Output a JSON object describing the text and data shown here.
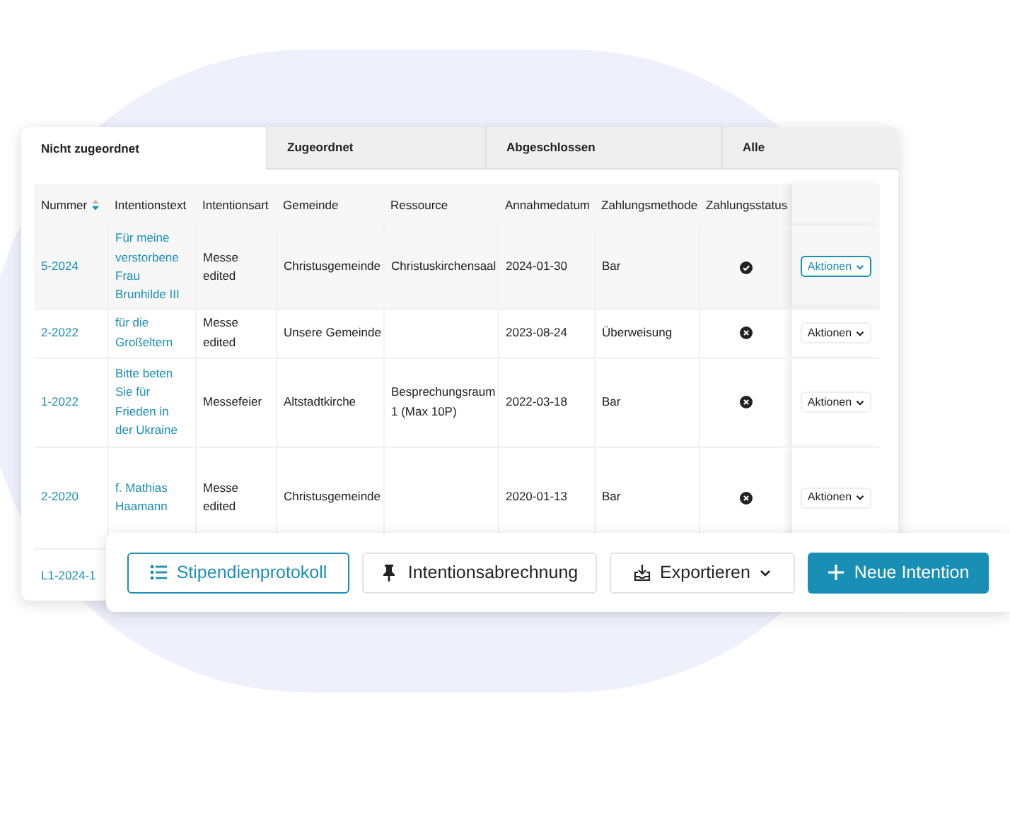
{
  "tabs": [
    {
      "label": "Nicht zugeordnet",
      "selected": true
    },
    {
      "label": "Zugeordnet",
      "selected": false
    },
    {
      "label": "Abgeschlossen",
      "selected": false
    },
    {
      "label": "Alle",
      "selected": false
    }
  ],
  "table": {
    "columns": [
      "Nummer",
      "Intentionstext",
      "Intentionsart",
      "Gemeinde",
      "Ressource",
      "Annahmedatum",
      "Zahlungsmethode",
      "Zahlungsstatus"
    ],
    "rows": [
      {
        "number": "5-2024",
        "text": "Für meine verstorbene Frau Brunhilde III",
        "type": "Messe edited",
        "parish": "Christusgemeinde",
        "resource": "Christuskirchensaal",
        "date": "2024-01-30",
        "payment": "Bar",
        "paid": true,
        "action": "Aktionen",
        "selected": true
      },
      {
        "number": "2-2022",
        "text": "für die Großeltern",
        "type": "Messe edited",
        "parish": "Unsere Gemeinde",
        "date": "2023-08-24",
        "payment": "Überweisung",
        "paid": false,
        "action": "Aktionen",
        "selected": false
      },
      {
        "number": "1-2022",
        "text": "Bitte beten Sie für Frieden in der Ukraine",
        "type": "Messefeier",
        "parish": "Altstadtkirche",
        "resource": "Besprechungsraum 1 (Max 10P)",
        "date": "2022-03-18",
        "payment": "Bar",
        "paid": false,
        "action": "Aktionen",
        "selected": false
      },
      {
        "number": "2-2020",
        "text": "f. Mathias Haamann",
        "type": "Messe edited",
        "parish": "Christusgemeinde",
        "date": "2020-01-13",
        "payment": "Bar",
        "paid": false,
        "action": "Aktionen",
        "selected": false
      },
      {
        "number": "L1-2024-1"
      }
    ]
  },
  "toolbar": [
    {
      "kind": "outline",
      "label": "Stipendienprotokoll"
    },
    {
      "kind": "plain",
      "label": "Intentionsabrechnung"
    },
    {
      "kind": "dropdown",
      "label": "Exportieren"
    },
    {
      "kind": "primary",
      "label": "Neue Intention"
    }
  ]
}
